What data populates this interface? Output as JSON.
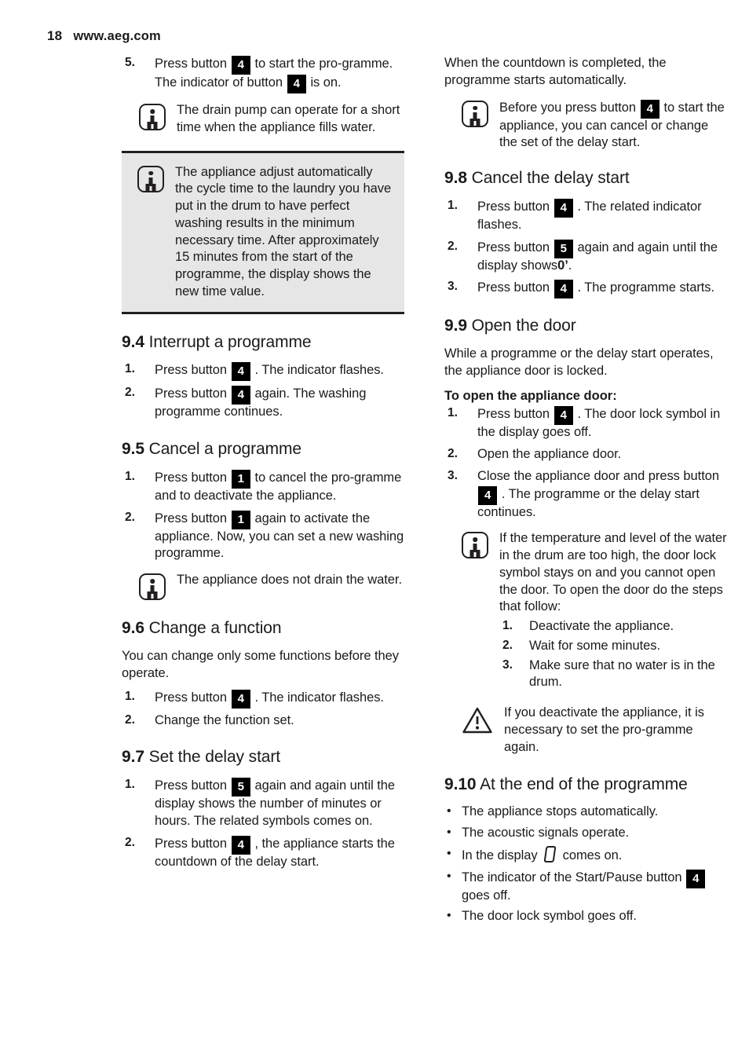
{
  "header": {
    "page_number": "18",
    "site_url": "www.aeg.com"
  },
  "icons": {
    "info": "info-icon",
    "warning": "warning-triangle-icon",
    "display_zero": "seven-segment-zero-icon",
    "bullet": "•"
  },
  "left_column": {
    "continued_step": {
      "marker": "5.",
      "text_before_1": "Press button",
      "chip_1": "4",
      "text_mid_1": "to start the pro-gramme. The indicator of button",
      "chip_2": "4",
      "text_after": "is on."
    },
    "note_drain_pump": "The drain pump can operate for a short time when the appliance fills water.",
    "note_shaded_cycle_time": "The appliance adjust automatically the cycle time to the laundry you have put in the drum to have perfect washing results in the minimum necessary time. After approximately 15 minutes from the start of the programme, the display shows the new time value.",
    "section_94": {
      "num": "9.4",
      "title": "Interrupt a programme",
      "steps": [
        {
          "marker": "1.",
          "before": "Press button",
          "chip": "4",
          "after": ". The indicator flashes."
        },
        {
          "marker": "2.",
          "before": "Press button",
          "chip": "4",
          "after": "again. The washing programme continues."
        }
      ]
    },
    "section_95": {
      "num": "9.5",
      "title": "Cancel a programme",
      "steps": [
        {
          "marker": "1.",
          "before": "Press button",
          "chip": "1",
          "after": "to cancel the pro-gramme and to deactivate the appliance."
        },
        {
          "marker": "2.",
          "before": "Press button",
          "chip": "1",
          "after": "again to activate the appliance. Now, you can set a new washing programme."
        }
      ],
      "note": "The appliance does not drain the water."
    },
    "section_96": {
      "num": "9.6",
      "title": "Change a function",
      "intro": "You can change only some functions before they operate.",
      "steps": [
        {
          "marker": "1.",
          "before": "Press button",
          "chip": "4",
          "after": ". The indicator flashes."
        },
        {
          "marker": "2.",
          "before": "Change the function set.",
          "chip": "",
          "after": ""
        }
      ]
    },
    "section_97": {
      "num": "9.7",
      "title": "Set the delay start",
      "steps": [
        {
          "marker": "1.",
          "before": "Press button",
          "chip": "5",
          "after": "again and again until the display shows the number of minutes or hours. The related symbols comes on."
        },
        {
          "marker": "2.",
          "before": "Press button",
          "chip": "4",
          "after": ", the appliance starts the countdown of the delay start."
        }
      ]
    }
  },
  "right_column": {
    "countdown_text": "When the countdown is completed, the programme starts automatically.",
    "note_before_press": {
      "before": "Before you press button",
      "chip": "4",
      "after": "to start the appliance, you can cancel or change the set of the delay start."
    },
    "section_98": {
      "num": "9.8",
      "title": "Cancel the delay start",
      "steps": [
        {
          "marker": "1.",
          "before": "Press button",
          "chip": "4",
          "after": ". The related indicator flashes."
        },
        {
          "marker": "2.",
          "before": "Press button",
          "chip": "5",
          "after_1": "again and again until the display shows",
          "bold": "0’",
          "after_2": "."
        },
        {
          "marker": "3.",
          "before": "Press button",
          "chip": "4",
          "after": ". The programme starts."
        }
      ]
    },
    "section_99": {
      "num": "9.9",
      "title": "Open the door",
      "intro": "While a programme or the delay start operates, the appliance door is locked.",
      "sub_heading": "To open the appliance door:",
      "steps": [
        {
          "marker": "1.",
          "before": "Press button",
          "chip": "4",
          "after": ". The door lock symbol in the display goes off."
        },
        {
          "marker": "2.",
          "before": "Open the appliance door.",
          "chip": "",
          "after": ""
        },
        {
          "marker": "3.",
          "before": "Close the appliance door and press button",
          "chip": "4",
          "after": ". The programme or the delay start continues."
        }
      ],
      "note_temperature": "If the temperature and level of the water in the drum are too high, the door lock symbol stays on and you cannot open the door. To open the door do the steps that follow:",
      "note_sub_steps": [
        {
          "marker": "1.",
          "text": "Deactivate the appliance."
        },
        {
          "marker": "2.",
          "text": "Wait for some minutes."
        },
        {
          "marker": "3.",
          "text": "Make sure that no water is in the drum."
        }
      ],
      "warning_note": "If you deactivate the appliance, it is necessary to set the pro-gramme again."
    },
    "section_910": {
      "num": "9.10",
      "title": "At the end of the programme",
      "bullets": [
        {
          "before": "The appliance stops automatically.",
          "glyph": false,
          "chip": "",
          "after": ""
        },
        {
          "before": "The acoustic signals operate.",
          "glyph": false,
          "chip": "",
          "after": ""
        },
        {
          "before": "In the display",
          "glyph": true,
          "chip": "",
          "after": "comes on."
        },
        {
          "before": "The indicator of the Start/Pause button",
          "glyph": false,
          "chip": "4",
          "after": "goes off."
        },
        {
          "before": "The door lock symbol goes off.",
          "glyph": false,
          "chip": "",
          "after": ""
        }
      ]
    }
  }
}
